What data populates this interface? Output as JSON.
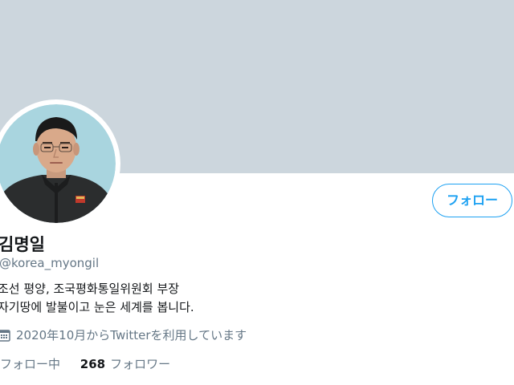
{
  "profile": {
    "display_name": "김명일",
    "handle": "@korea_myongil",
    "bio_lines": [
      "조선 평양, 조국평화통일위원회 부장",
      "자기땅에 발불이고 눈은 세계를 봅니다."
    ],
    "joined_text": "2020年10月からTwitterを利用しています",
    "following_label": "フォロー中",
    "followers_count": "268",
    "followers_label": "フォロワー"
  },
  "actions": {
    "follow_label": "フォロー"
  },
  "colors": {
    "banner": "#ccd6dd",
    "accent": "#1da1f2",
    "secondary_text": "#657786",
    "primary_text": "#14171a"
  },
  "icons": {
    "joined": "calendar-icon"
  }
}
